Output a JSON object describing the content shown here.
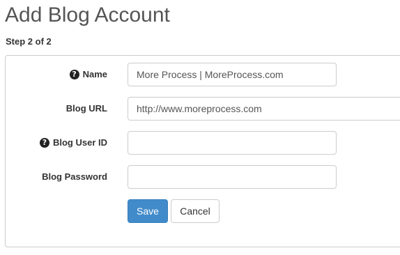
{
  "header": {
    "title": "Add Blog Account",
    "step": "Step 2 of 2"
  },
  "form": {
    "fields": [
      {
        "label": "Name",
        "value": "More Process | MoreProcess.com",
        "has_help_icon": true
      },
      {
        "label": "Blog URL",
        "value": "http://www.moreprocess.com",
        "has_help_icon": false
      },
      {
        "label": "Blog User ID",
        "value": "",
        "has_help_icon": true
      },
      {
        "label": "Blog Password",
        "value": "",
        "has_help_icon": false
      }
    ],
    "help_icon": "question-circle-icon",
    "save_label": "Save",
    "cancel_label": "Cancel"
  },
  "colors": {
    "primary": "#428bca",
    "border": "#cccccc",
    "title": "#555555"
  }
}
